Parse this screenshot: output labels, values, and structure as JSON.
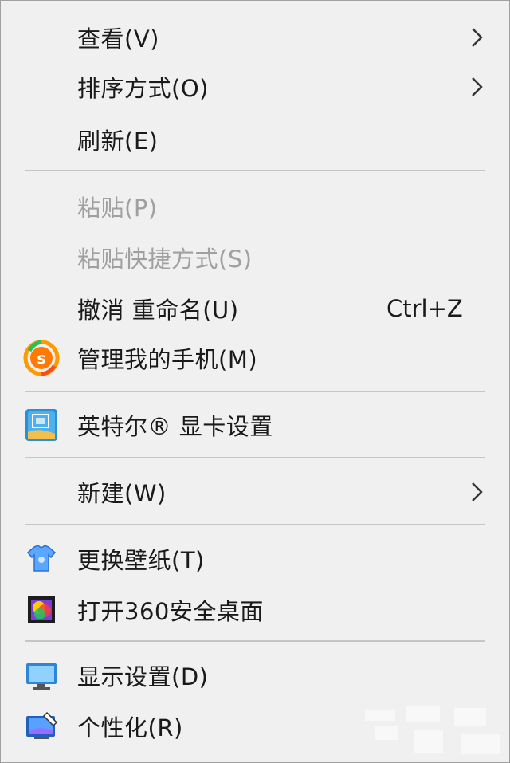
{
  "menu": {
    "view": {
      "label": "查看(V)"
    },
    "sort": {
      "label": "排序方式(O)"
    },
    "refresh": {
      "label": "刷新(E)"
    },
    "paste": {
      "label": "粘贴(P)"
    },
    "paste_shortcut": {
      "label": "粘贴快捷方式(S)"
    },
    "undo_rename": {
      "label": "撤消 重命名(U)",
      "shortcut": "Ctrl+Z"
    },
    "manage_phone": {
      "label": "管理我的手机(M)",
      "icon": "360-s-logo-icon"
    },
    "intel_graphics": {
      "label": "英特尔® 显卡设置",
      "icon": "intel-graphics-icon"
    },
    "new": {
      "label": "新建(W)"
    },
    "change_wallpaper": {
      "label": "更换壁纸(T)",
      "icon": "tshirt-icon"
    },
    "open_360_desktop": {
      "label": "打开360安全桌面",
      "icon": "360-desktop-icon"
    },
    "display_settings": {
      "label": "显示设置(D)",
      "icon": "monitor-icon"
    },
    "personalize": {
      "label": "个性化(R)",
      "icon": "personalize-icon"
    }
  },
  "colors": {
    "background": "#f0f0f0",
    "text": "#1a1a1a",
    "disabled_text": "#a0a0a0",
    "separator": "#c6c6c6"
  }
}
